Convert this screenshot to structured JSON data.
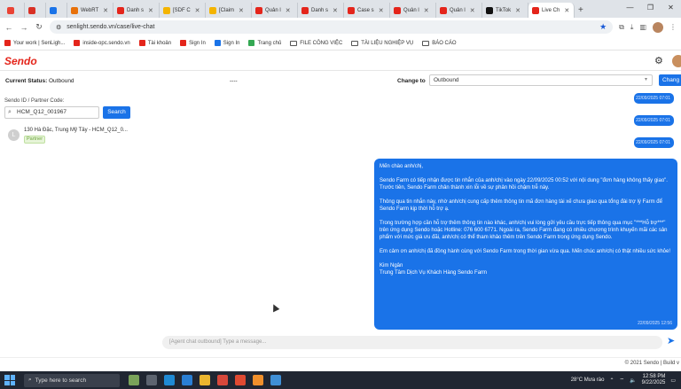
{
  "browser": {
    "tabs": [
      {
        "label": "",
        "color": "#ea4335"
      },
      {
        "label": "",
        "color": "#d93025"
      },
      {
        "label": "",
        "color": "#1a73e8"
      },
      {
        "label": "WebRT",
        "color": "#e8710a"
      },
      {
        "label": "Danh s",
        "color": "#e4251b"
      },
      {
        "label": "[SDF C",
        "color": "#f4b400"
      },
      {
        "label": "[Claim",
        "color": "#f4b400"
      },
      {
        "label": "Quản l",
        "color": "#e4251b"
      },
      {
        "label": "Danh s",
        "color": "#e4251b"
      },
      {
        "label": "Case s",
        "color": "#e4251b"
      },
      {
        "label": "Quản l",
        "color": "#e4251b"
      },
      {
        "label": "Quản l",
        "color": "#e4251b"
      },
      {
        "label": "TikTok",
        "color": "#111111"
      },
      {
        "label": "Live Ch",
        "color": "#e4251b"
      }
    ],
    "url": "senlight.sendo.vn/case/live-chat",
    "bookmarks": [
      {
        "label": "Your work | SenLigh...",
        "type": "site",
        "color": "#e4251b"
      },
      {
        "label": "inside-opc.sendo.vn",
        "type": "site",
        "color": "#e4251b"
      },
      {
        "label": "Tài khoản",
        "type": "site",
        "color": "#e4251b"
      },
      {
        "label": "Sign In",
        "type": "site",
        "color": "#e4251b"
      },
      {
        "label": "Sign In",
        "type": "site",
        "color": "#1a73e8"
      },
      {
        "label": "Trang chủ",
        "type": "site",
        "color": "#34a853"
      },
      {
        "label": "FILE CÔNG VIỆC",
        "type": "folder"
      },
      {
        "label": "TÀI LIỆU NGHIỆP VỤ",
        "type": "folder"
      },
      {
        "label": "BÁO CÁO",
        "type": "folder"
      }
    ]
  },
  "app": {
    "logo": "Sendo",
    "status_label": "Current Status:",
    "status_value": "Outbound",
    "status_dash": "----",
    "change_label": "Change to",
    "change_value": "Outbound",
    "change_button": "Chang",
    "sid_label": "Sendo ID / Partner Code:",
    "sid_value": "HCM_Q12_001967",
    "search_button": "Search",
    "contact": {
      "avatar": "L",
      "address": "130 Hà Đặc, Trung Mỹ Tây - HCM_Q12_0...",
      "badge": "Partner"
    },
    "timestamps": [
      "22/09/2025 07:01",
      "22/09/2025 07:01",
      "22/09/2025 07:01"
    ],
    "message": {
      "greeting": "Mến chào anh/chị,",
      "p1": "Sendo Farm có tiếp nhận được tin nhắn của anh/chị vào ngày 22/09/2025 00:52 với nội dung \"đơn hàng không thấy giao\". Trước tiên, Sendo Farm chân thành xin lỗi về sự phản hồi chậm trễ này.",
      "p2": "Thông qua tin nhắn này, nhờ anh/chị cung cấp thêm thông tin mã đơn hàng tài xế chưa giao qua tổng đài trợ lý Farm để Sendo Farm kịp thời hỗ trợ ạ.",
      "p3": "Trong trường hợp cần hỗ trợ thêm thông tin nào khác, anh/chị vui lòng gửi yêu cầu trực tiếp thông qua mục \"***Hỗ trợ***\" trên ứng dụng Sendo hoặc Hotline: 076 600 6771. Ngoài ra, Sendo Farm đang có nhiều chương trình khuyến mãi các sản phẩm với mức giá ưu đãi, anh/chị có thể tham khảo thêm trên Sendo Farm trong ứng dụng Sendo.",
      "p4": "Em cảm ơn anh/chị đã đồng hành cùng với Sendo Farm trong thời gian vừa qua. Mến chúc anh/chị có thật nhiều sức khỏe!",
      "sign_name": "Kim Ngân",
      "sign_team": "Trung Tâm Dịch Vụ Khách Hàng Sendo Farm",
      "timestamp": "22/09/2025 12:56"
    },
    "composer_placeholder": "[Agent chat outbound] Type a message...",
    "footer": "© 2021 Sendo | Build v"
  },
  "taskbar": {
    "search_placeholder": "Type here to search",
    "weather": "28°C  Mưa rào",
    "time": "12:58 PM",
    "date": "9/22/2025"
  }
}
